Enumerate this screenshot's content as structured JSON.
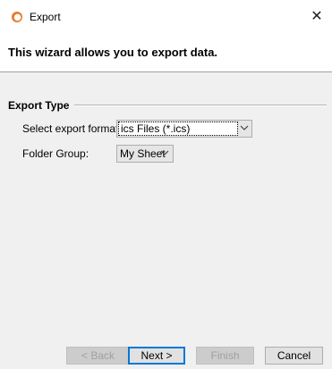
{
  "window": {
    "title": "Export",
    "close_glyph": "✕",
    "app_icon": "circle-logo-icon"
  },
  "header": {
    "text": "This wizard allows you to export data."
  },
  "export_type": {
    "group_title": "Export Type",
    "format_label": "Select export format:",
    "format_value": "ics Files (*.ics)",
    "folder_label": "Folder Group:",
    "folder_value": "My Sheet"
  },
  "buttons": {
    "back": "< Back",
    "next": "Next >",
    "finish": "Finish",
    "cancel": "Cancel"
  },
  "colors": {
    "accent": "#0078d7",
    "icon_orange": "#e8792a"
  }
}
